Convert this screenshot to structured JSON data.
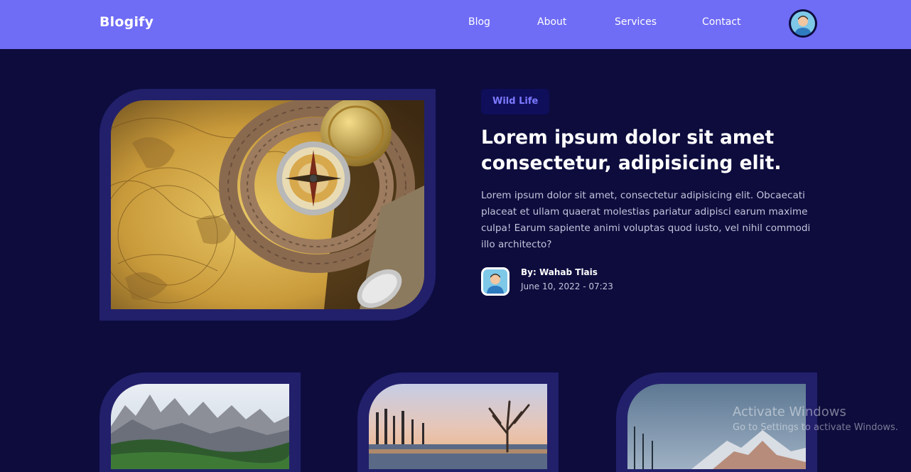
{
  "nav": {
    "brand": "Blogify",
    "links": [
      "Blog",
      "About",
      "Services",
      "Contact"
    ],
    "avatar_icon": "user-avatar-icon"
  },
  "hero": {
    "tag": "Wild Life",
    "title": "Lorem ipsum dolor sit amet consectetur, adipisicing elit.",
    "body": "Lorem ipsum dolor sit amet, consectetur adipisicing elit. Obcaecati placeat et ullam quaerat molestias pariatur adipisci earum maxime culpa! Earum sapiente animi voluptas quod iusto, vel nihil commodi illo architecto?",
    "author": "By: Wahab Tlais",
    "date": "June 10, 2022 - 07:23",
    "image": "compass-map-photo"
  },
  "cards": [
    {
      "image": "mountain-photo"
    },
    {
      "image": "lake-tree-sunset-photo"
    },
    {
      "image": "snowy-peak-photo"
    }
  ],
  "watermark": {
    "title": "Activate Windows",
    "subtitle": "Go to Settings to activate Windows."
  },
  "colors": {
    "background": "#0d0c3d",
    "nav": "#6f6cf5",
    "frame": "#22206b",
    "tag_bg": "#0f0e5a",
    "tag_text": "#7c79ff"
  }
}
